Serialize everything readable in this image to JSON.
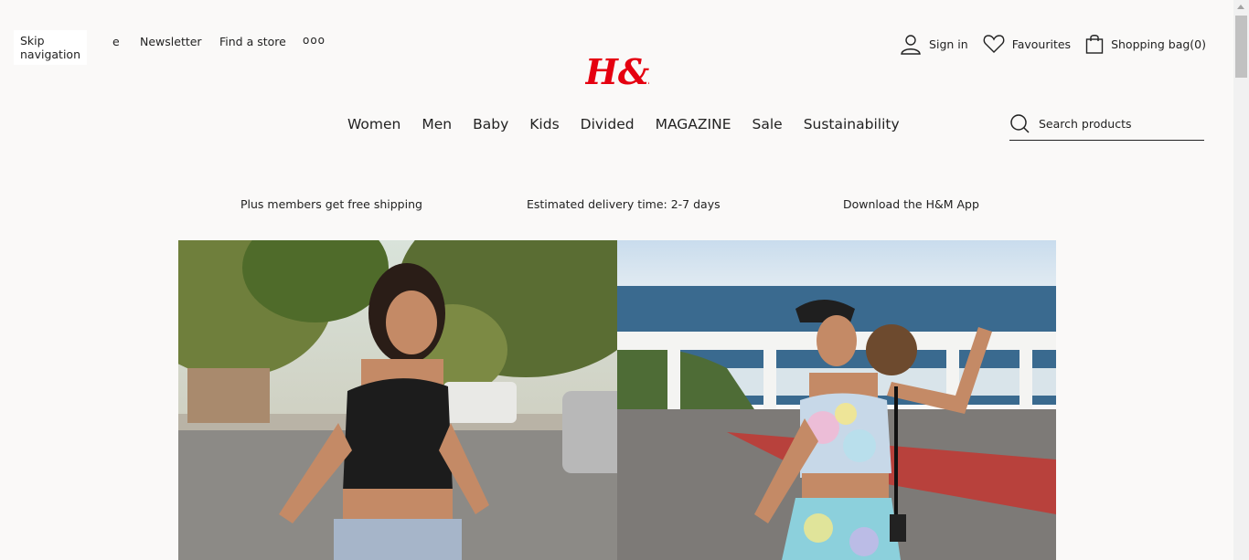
{
  "topbar": {
    "skip_label": "Skip navigation",
    "cut_text": "e",
    "links": [
      "Newsletter",
      "Find a store"
    ],
    "more_label": "ooo"
  },
  "brand": {
    "logo_text": "H&M",
    "color": "#e50010"
  },
  "account": {
    "signin": "Sign in",
    "favourites": "Favourites",
    "bag": "Shopping bag(0)"
  },
  "nav": {
    "items": [
      "Women",
      "Men",
      "Baby",
      "Kids",
      "Divided",
      "MAGAZINE",
      "Sale",
      "Sustainability"
    ]
  },
  "search": {
    "placeholder": "Search products"
  },
  "promos": [
    "Plus members get free shipping",
    "Estimated delivery time: 2-7 days",
    "Download the H&M App"
  ],
  "hero": {
    "left_image": "woman-black-crop-top-street",
    "right_image": "woman-tie-dye-set-ocean-view"
  }
}
